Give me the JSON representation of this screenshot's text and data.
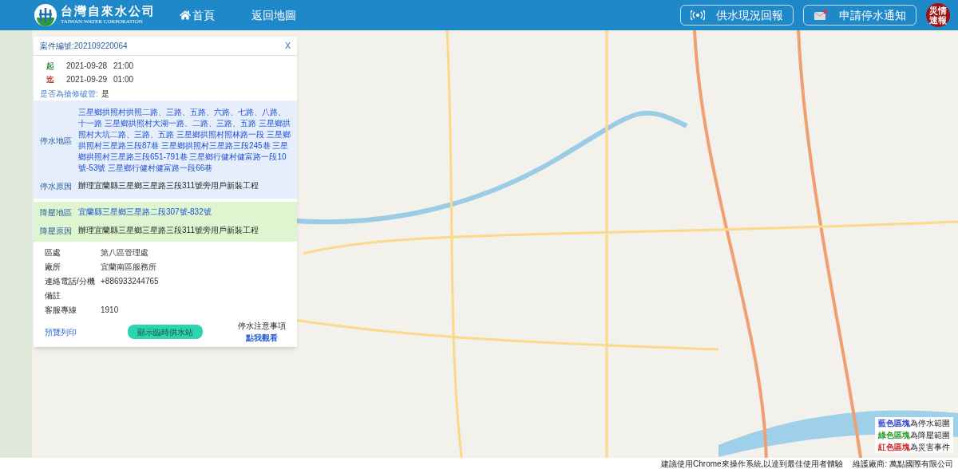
{
  "header": {
    "logo_title": "台灣自來水公司",
    "logo_subtitle": "TAIWAN WATER CORPORATION",
    "nav": [
      {
        "label": "首頁",
        "kind": "home"
      },
      {
        "label": "返回地圖",
        "kind": "plain"
      }
    ],
    "actions": [
      {
        "label": "供水現況回報",
        "kind": "signal"
      },
      {
        "label": "申請停水通知",
        "kind": "mail"
      }
    ],
    "disaster_badge": "災情速報"
  },
  "case_panel": {
    "case_number": "案件編號:202109220064",
    "close": "X",
    "times": [
      {
        "mark": "起",
        "date": "2021-09-28",
        "time": "21:00",
        "color": "#2e8b3a"
      },
      {
        "mark": "迄",
        "date": "2021-09-29",
        "time": "01:00",
        "color": "#b23a2a"
      }
    ],
    "repair": {
      "label": "是否為搶修破管:",
      "value": "是"
    },
    "outage": [
      {
        "label": "停水地區",
        "value": "三星鄉拱照村拱照二路、三路、五路、六路、七路、八路、十一路 三星鄉拱照村大湖一路、二路、三路、五路 三星鄉拱照村大坑二路、三路、五路 三星鄉拱照村照林路一段 三星鄉拱照村三星路三段87巷 三星鄉拱照村三星路三段245巷 三星鄉拱照村三星路三段651-791巷 三星鄉行健村健富路一段10號-53號 三星鄉行健村健富路一段66巷",
        "kind": "link"
      },
      {
        "label": "停水原因",
        "value": "辦理宜蘭縣三星鄉三星路三段311號旁用戶新裝工程",
        "kind": "plain"
      }
    ],
    "pressure": [
      {
        "label": "降壓地區",
        "value": "宜蘭縣三星鄉三星路二段307號-832號",
        "kind": "link"
      },
      {
        "label": "降壓原因",
        "value": "辦理宜蘭縣三星鄉三星路三段311號旁用戶新裝工程",
        "kind": "plain"
      }
    ],
    "info": [
      {
        "label": "區處",
        "value": "第八區管理處"
      },
      {
        "label": "廠所",
        "value": "宜蘭南區服務所"
      },
      {
        "label": "連絡電話/分機",
        "value": "+886933244765"
      },
      {
        "label": "備註"
      },
      {
        "label": "客服專線",
        "value": "1910"
      }
    ],
    "print_link": "預覽列印",
    "stations_button": "顯示臨時供水站",
    "notice_title": "停水注意事項",
    "notice_link": "點我觀看"
  },
  "legend": [
    {
      "highlight": "藍色區塊",
      "text": "為停水範圍",
      "color": "#2b3fd0"
    },
    {
      "highlight": "綠色區塊",
      "text": "為降壓範圍",
      "color": "#2a9a2a"
    },
    {
      "highlight": "紅色區塊",
      "text": "為災害事件",
      "color": "#d02020"
    }
  ],
  "footer": {
    "notice": "建議使用Chrome來操作系統,以達到最佳使用者體驗",
    "maintainer": "維護廠商: 萬點國際有限公司"
  }
}
